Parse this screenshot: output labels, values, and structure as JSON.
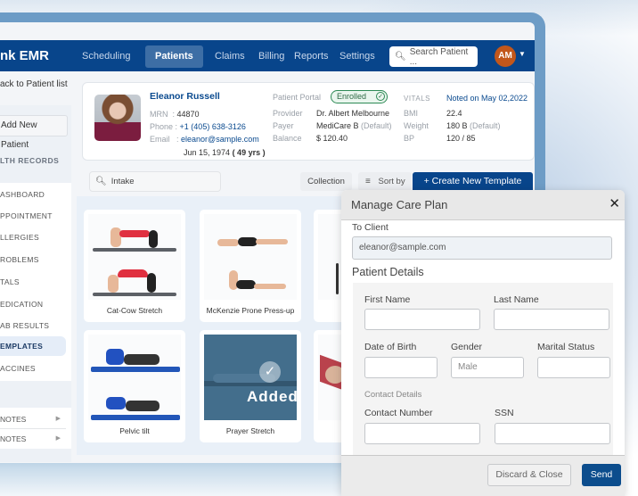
{
  "app": {
    "brand": "nk EMR"
  },
  "nav": {
    "items": [
      {
        "label": "Scheduling"
      },
      {
        "label": "Patients",
        "active": true
      },
      {
        "label": "Claims"
      },
      {
        "label": "Billing"
      },
      {
        "label": "Reports"
      },
      {
        "label": "Settings"
      }
    ],
    "search_placeholder": "Search Patient ...",
    "avatar_initials": "AM"
  },
  "sidebar": {
    "back_link": "ack to Patient list",
    "add_patient": "Add New Patient",
    "section_header": "LTH RECORDS",
    "items": [
      {
        "label": "ASHBOARD"
      },
      {
        "label": "PPOINTMENT"
      },
      {
        "label": "LLERGIES"
      },
      {
        "label": "ROBLEMS"
      },
      {
        "label": "TALS"
      },
      {
        "label": "EDICATION"
      },
      {
        "label": "AB RESULTS"
      },
      {
        "label": "EMPLATES",
        "active": true
      },
      {
        "label": "ACCINES"
      }
    ],
    "notes": [
      {
        "label": "NOTES"
      },
      {
        "label": "NOTES"
      }
    ]
  },
  "patient": {
    "name": "Eleanor Russell",
    "mrn_label": "MRN",
    "mrn": "44870",
    "phone_label": "Phone",
    "phone": "+1 (405) 638-3126",
    "email_label": "Email",
    "email": "eleanor@sample.com",
    "dob": "Jun 15, 1974",
    "age": "( 49 yrs )",
    "portal_label": "Patient Portal",
    "portal_status": "Enrolled",
    "provider_label": "Provider",
    "provider": "Dr. Albert Melbourne",
    "payer_label": "Payer",
    "payer": "MediCare B",
    "payer_note": "(Default)",
    "balance_label": "Balance",
    "balance": "$ 120.40",
    "vitals_label": "VITALS",
    "vitals_noted": "Noted on May 02,2022",
    "bmi_label": "BMI",
    "bmi": "22.4",
    "weight_label": "Weight",
    "weight": "180 B",
    "weight_note": "(Default)",
    "bp_label": "BP",
    "bp": "120 / 85"
  },
  "toolbar": {
    "search_value": "Intake",
    "collection": "Collection",
    "sort": "Sort by",
    "create": "+ Create New Template"
  },
  "templates": [
    {
      "name": "Cat-Cow Stretch"
    },
    {
      "name": "McKenzie Prone Press-up"
    },
    {
      "name": "Pelvic tilt"
    },
    {
      "name": "Prayer Stretch",
      "added": true,
      "added_label": "Added"
    }
  ],
  "modal": {
    "title": "Manage Care Plan",
    "to_client_label": "To Client",
    "to_client_value": "eleanor@sample.com",
    "patient_details_label": "Patient Details",
    "first_name_label": "First Name",
    "last_name_label": "Last Name",
    "dob_label": "Date of Birth",
    "gender_label": "Gender",
    "gender_placeholder": "Male",
    "marital_label": "Marital Status",
    "contact_details_label": "Contact Details",
    "contact_number_label": "Contact Number",
    "ssn_label": "SSN",
    "discard": "Discard & Close",
    "send": "Send"
  }
}
